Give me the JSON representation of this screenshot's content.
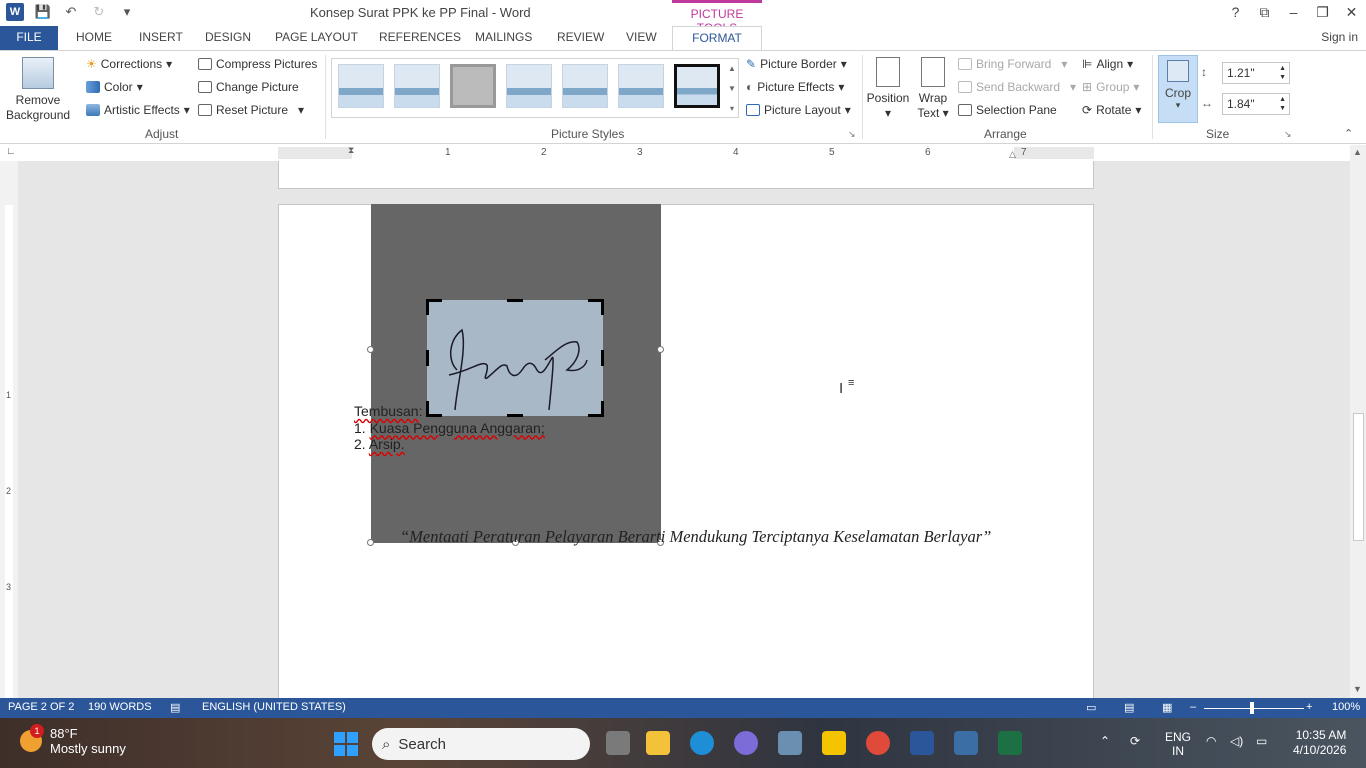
{
  "window": {
    "title": "Konsep Surat PPK ke PP Final - Word",
    "contextual_tab_group": "PICTURE TOOLS",
    "controls": [
      "?",
      "⧉",
      "–",
      "❐",
      "✕"
    ]
  },
  "qat": {
    "word_logo": "W",
    "save": "💾",
    "undo": "↶",
    "redo": "↻",
    "more": "▾"
  },
  "tabs": {
    "file": "FILE",
    "items": [
      "HOME",
      "INSERT",
      "DESIGN",
      "PAGE LAYOUT",
      "REFERENCES",
      "MAILINGS",
      "REVIEW",
      "VIEW"
    ],
    "active": "FORMAT",
    "signin": "Sign in"
  },
  "ribbon": {
    "adjust": {
      "remove_background": [
        "Remove",
        "Background"
      ],
      "corrections": "Corrections",
      "color": "Color",
      "artistic_effects": "Artistic Effects",
      "compress": "Compress Pictures",
      "change": "Change Picture",
      "reset": "Reset Picture",
      "label": "Adjust"
    },
    "styles": {
      "picture_border": "Picture Border",
      "picture_effects": "Picture Effects",
      "picture_layout": "Picture Layout",
      "label": "Picture Styles"
    },
    "arrange": {
      "position": "Position",
      "wrap_text": [
        "Wrap",
        "Text"
      ],
      "bring_forward": "Bring Forward",
      "send_backward": "Send Backward",
      "selection_pane": "Selection Pane",
      "align": "Align",
      "group": "Group",
      "rotate": "Rotate",
      "label": "Arrange"
    },
    "size": {
      "crop": "Crop",
      "height": "1.21\"",
      "width": "1.84\"",
      "label": "Size"
    }
  },
  "ruler": {
    "numbers": [
      "1",
      "2",
      "3",
      "4",
      "5",
      "6",
      "7"
    ]
  },
  "vruler": {
    "numbers": [
      "1",
      "2",
      "3"
    ]
  },
  "document": {
    "tembusan_label": "Tembusan",
    "items": [
      {
        "num": "1.",
        "text": "Kuasa Pengguna Anggaran;"
      },
      {
        "num": "2.",
        "text": "Arsip."
      }
    ],
    "motto": "“Mentaati Peraturan Pelayaran Berarti Mendukung Terciptanya Keselamatan Berlayar”"
  },
  "status": {
    "page": "PAGE 2 OF 2",
    "words": "190 WORDS",
    "language": "ENGLISH (UNITED STATES)",
    "zoom": "100%",
    "zoom_level": 1.0
  },
  "taskbar": {
    "weather_temp": "88°F",
    "weather_desc": "Mostly sunny",
    "notification_count": "1",
    "search_placeholder": "Search",
    "lang_top": "ENG",
    "lang_bottom": "IN",
    "time": "10:35 AM",
    "date": "4/10/2026"
  }
}
